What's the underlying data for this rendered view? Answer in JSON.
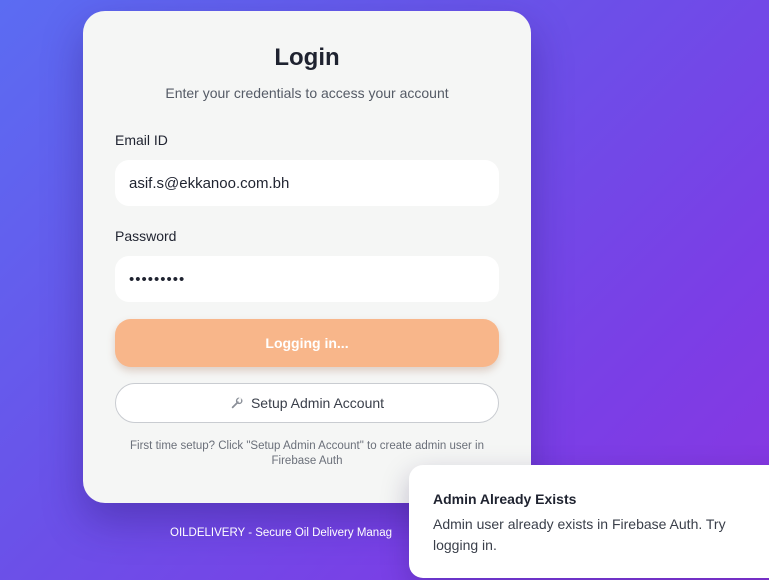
{
  "login": {
    "title": "Login",
    "subtitle": "Enter your credentials to access your account",
    "email_label": "Email ID",
    "email_value": "asif.s@ekkanoo.com.bh",
    "password_label": "Password",
    "password_value": "•••••••••",
    "login_button": "Logging in...",
    "setup_button": "Setup Admin Account",
    "setup_icon": "wrench-icon",
    "help_text": "First time setup? Click \"Setup Admin Account\" to create admin user in Firebase Auth"
  },
  "footer": {
    "text": "OILDELIVERY - Secure Oil Delivery Manag"
  },
  "toast": {
    "title": "Admin Already Exists",
    "message": "Admin user already exists in Firebase Auth. Try logging in."
  },
  "colors": {
    "login_button_bg": "#f8b68a",
    "card_bg": "#f5f6f5",
    "gradient_start": "#5b6cf2",
    "gradient_end": "#8a36e0"
  }
}
